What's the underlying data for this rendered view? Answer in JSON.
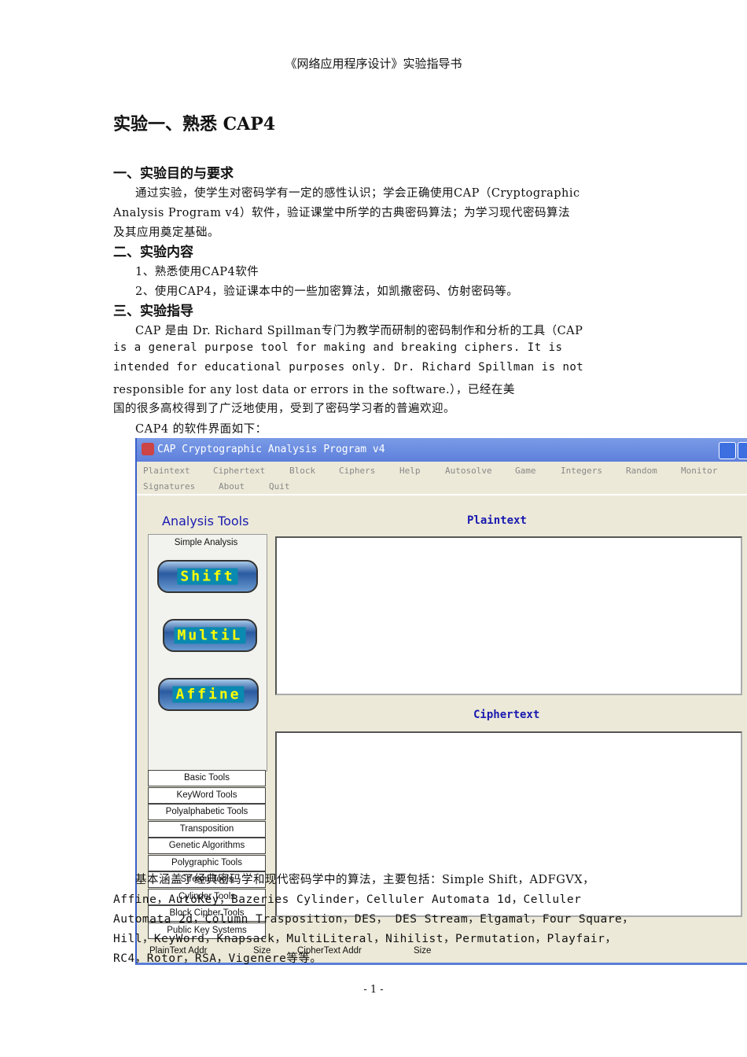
{
  "header": "《网络应用程序设计》实验指导书",
  "title": "实验一、熟悉 CAP4",
  "s1": {
    "heading": "一、实验目的与要求",
    "lines": [
      "通过实验，使学生对密码学有一定的感性认识；学会正确使用CAP（Cryptographic",
      "Analysis Program v4）软件，验证课堂中所学的古典密码算法；为学习现代密码算法",
      "及其应用奠定基础。"
    ]
  },
  "s2": {
    "heading": "二、实验内容",
    "lines": [
      "1、熟悉使用CAP4软件",
      "2、使用CAP4，验证课本中的一些加密算法，如凯撒密码、仿射密码等。"
    ]
  },
  "s3": {
    "heading": "三、实验指导",
    "lines": [
      "CAP 是由 Dr. Richard Spillman专门为教学而研制的密码制作和分析的工具（CAP",
      "is a general purpose tool for making and breaking ciphers. It is",
      "intended for educational purposes only. Dr. Richard Spillman is not",
      "responsible for any lost data or errors in the software.），已经在美",
      "国的很多高校得到了广泛地使用，受到了密码学习者的普遍欢迎。",
      "CAP4 的软件界面如下："
    ]
  },
  "after": [
    "基本涵盖了经典密码学和现代密码学中的算法，主要包括：Simple Shift，ADFGVX，",
    "Affine，AutoKey，Bazeries Cylinder，Celluler Automata 1d，Celluler",
    "Automata 2d，Column Trasposition，DES， DES Stream，Elgamal，Four Square，",
    "Hill，KeyWord，Knapsack，MultiLiteral，Nihilist，Permutation，Playfair，",
    "RC4，Rotor，RSA，Vigenere等等。"
  ],
  "app": {
    "title": "CAP  Cryptographic Analysis Program v4",
    "menu": [
      "Plaintext",
      "Ciphertext",
      "Block",
      "Ciphers",
      "Help",
      "Autosolve",
      "Game",
      "Integers",
      "Random",
      "Monitor",
      "Signatures",
      "About",
      "Quit"
    ],
    "analysis_tools": "Analysis Tools",
    "simple_analysis": "Simple Analysis",
    "buttons": [
      "Shift",
      "MultiL",
      "Affine"
    ],
    "plaintext_label": "Plaintext",
    "ciphertext_label": "Ciphertext",
    "tools": [
      "Basic Tools",
      "KeyWord Tools",
      "Polyalphabetic Tools",
      "Transposition",
      "Genetic Algorithms",
      "Polygraphic Tools",
      "Stream Tools",
      "Cylinder Tools",
      "Block Cipher Tools",
      "Public Key Systems"
    ],
    "status": [
      "PlainText Addr",
      "Size",
      "CipherText Addr",
      "Size"
    ]
  },
  "footer": "- 1 -"
}
